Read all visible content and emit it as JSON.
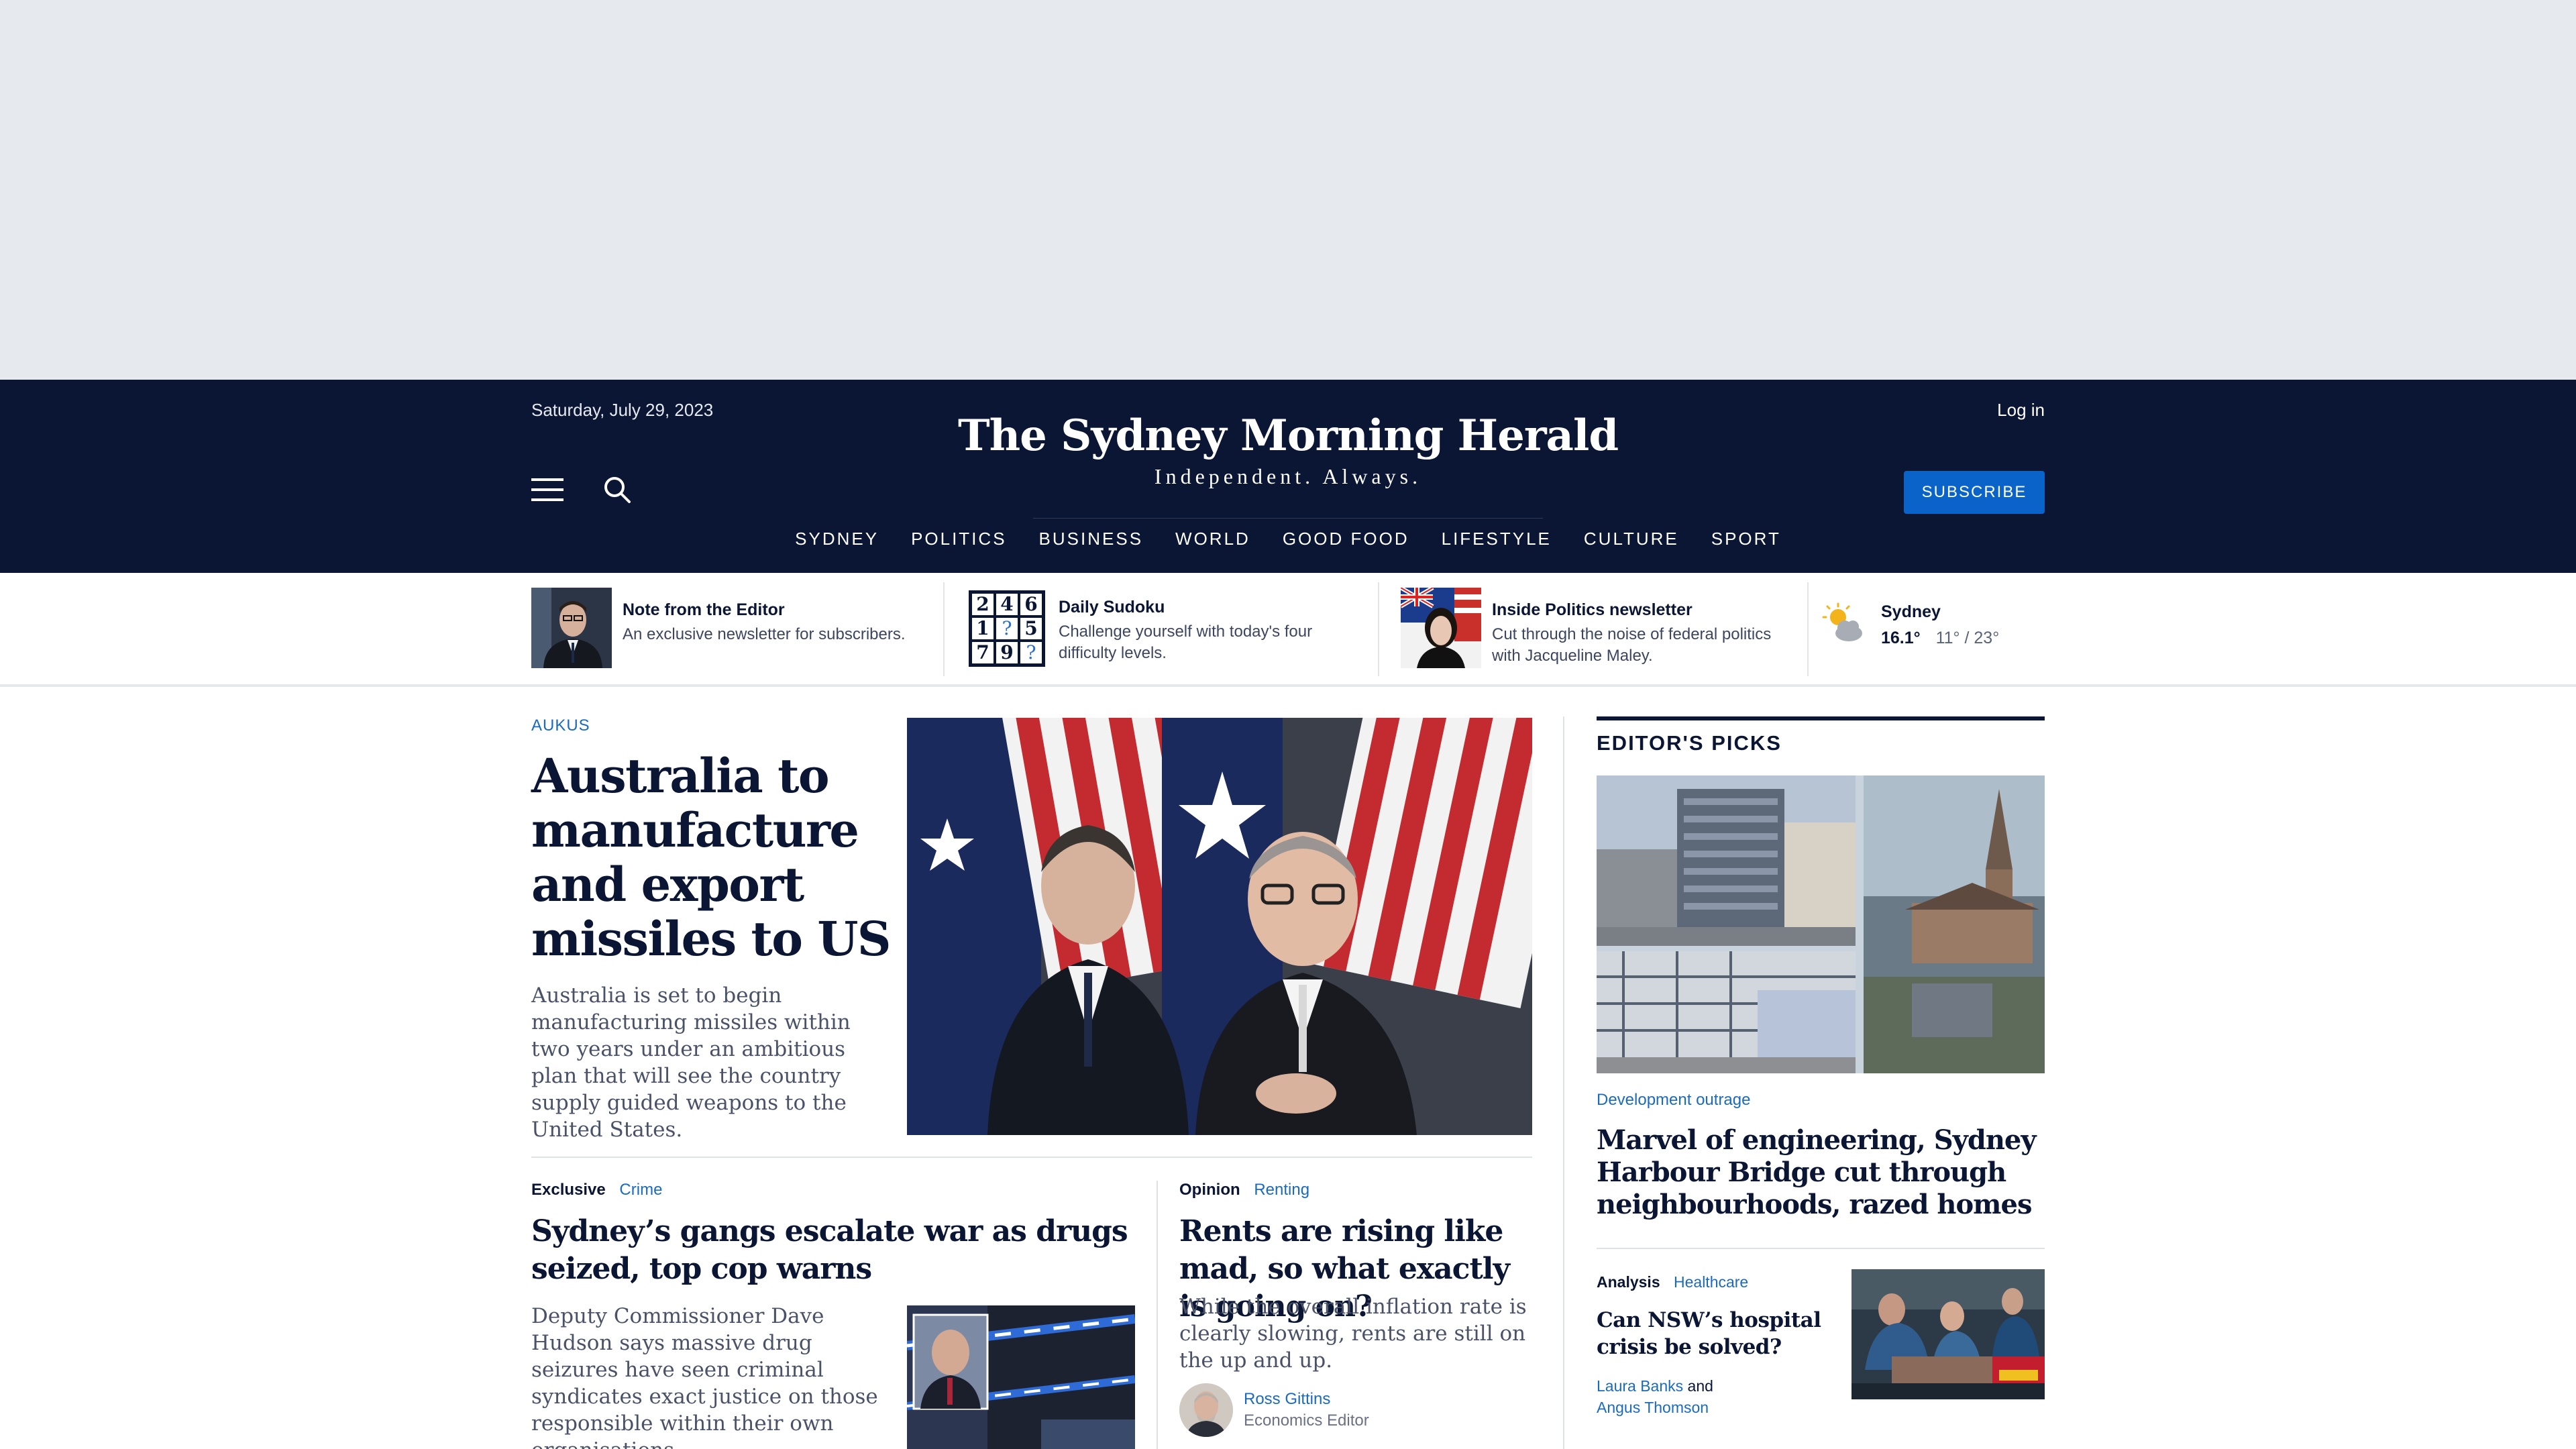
{
  "masthead": {
    "date": "Saturday, July 29, 2023",
    "login": "Log in",
    "logo_name": "The Sydney Morning Herald",
    "tagline": "Independent. Always.",
    "subscribe": "SUBSCRIBE",
    "nav": [
      "SYDNEY",
      "POLITICS",
      "BUSINESS",
      "WORLD",
      "GOOD FOOD",
      "LIFESTYLE",
      "CULTURE",
      "SPORT"
    ],
    "colors": {
      "background": "#0a1633",
      "subscribe": "#0a63c9"
    }
  },
  "promos": [
    {
      "title": "Note from the Editor",
      "desc": [
        "An exclusive newsletter for subscribers."
      ]
    },
    {
      "title": "Daily Sudoku",
      "desc": [
        "Challenge yourself with today's four",
        "difficulty levels."
      ],
      "grid": [
        "2",
        "4",
        "6",
        "1",
        "?",
        "5",
        "7",
        "9",
        "?"
      ]
    },
    {
      "title": "Inside Politics newsletter",
      "desc": [
        "Cut through the noise of federal politics",
        "with Jacqueline Maley."
      ]
    }
  ],
  "weather": {
    "city": "Sydney",
    "temp": "16.1°",
    "range": "11° / 23°",
    "icon": "partly-cloudy-icon"
  },
  "lead": {
    "kicker": "AUKUS",
    "headline": "Australia to manufacture and export missiles to US",
    "summary": "Australia is set to begin manufacturing missiles within two years under an ambitious plan that will see the country supply guided weapons to the United States."
  },
  "story1": {
    "tag": "Exclusive",
    "category": "Crime",
    "headline": "Sydney’s gangs escalate war as drugs seized, top cop warns",
    "summary": "Deputy Commissioner Dave Hudson says massive drug seizures have seen criminal syndicates exact justice on those responsible within their own organisations."
  },
  "story2": {
    "tag": "Opinion",
    "category": "Renting",
    "headline": "Rents are rising like mad, so what exactly is going on?",
    "summary": "While the overall inflation rate is clearly slowing, rents are still on the up and up.",
    "author": "Ross Gittins",
    "role": "Economics Editor"
  },
  "editors_picks": {
    "title": "EDITOR'S PICKS",
    "kicker": "Development outrage",
    "headline": "Marvel of engineering, Sydney Harbour Bridge cut through neighbourhoods, razed homes",
    "item2": {
      "tag": "Analysis",
      "category": "Healthcare",
      "headline": "Can NSW’s hospital crisis be solved?",
      "author1": "Laura Banks",
      "joiner": "and",
      "author2": "Angus Thomson"
    }
  }
}
